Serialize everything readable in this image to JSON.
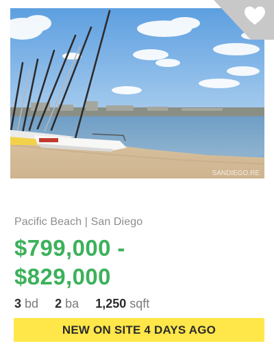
{
  "listing": {
    "location": "Pacific Beach | San Diego",
    "price_line1": "$799,000 -",
    "price_line2": "$829,000",
    "beds": "3",
    "beds_unit": "bd",
    "baths": "2",
    "baths_unit": "ba",
    "sqft": "1,250",
    "sqft_unit": "sqft",
    "badge": "NEW ON SITE 4 DAYS AGO",
    "photo_watermark": "SANDIEGO.RE",
    "favorite_icon": "heart-icon"
  },
  "colors": {
    "price": "#3bb15a",
    "badge_background": "#ffe74a",
    "location_text": "#8c8c8c",
    "favorite_corner": "#c8c8c8"
  }
}
